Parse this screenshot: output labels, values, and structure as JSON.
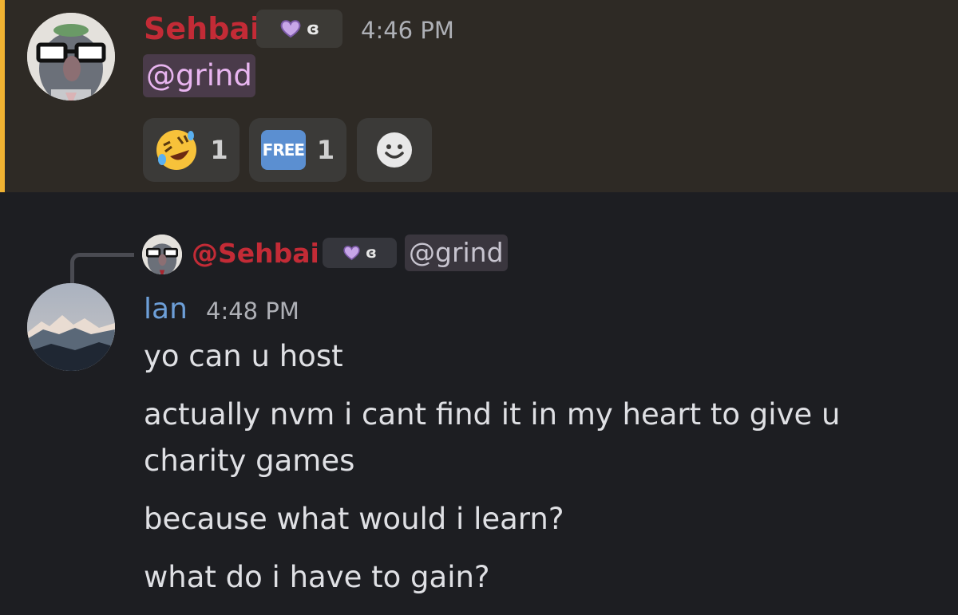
{
  "message1": {
    "username": "Sehbai",
    "tag": "ɞ",
    "timestamp": "4:46 PM",
    "mention": "@grind",
    "reactions": [
      {
        "emoji": "rolling-on-floor-laughing",
        "count": "1"
      },
      {
        "emoji": "FREE",
        "count": "1"
      },
      {
        "emoji": "add-reaction-icon"
      }
    ]
  },
  "message2": {
    "reply": {
      "username": "@Sehbai",
      "tag": "ɞ",
      "mention": "@grind"
    },
    "username": "lan",
    "timestamp": "4:48 PM",
    "lines": [
      "yo can u host",
      "actually nvm i cant find it in my heart to give u",
      "charity games",
      "because what would i learn?",
      "what do i have to gain?"
    ]
  },
  "colors": {
    "mention_highlight_bg": "#2e2a25",
    "mention_bar": "#f0b232",
    "username_red": "#c32b36",
    "username_blue": "#6d9fd8",
    "mention_text": "#e8b5f0"
  }
}
